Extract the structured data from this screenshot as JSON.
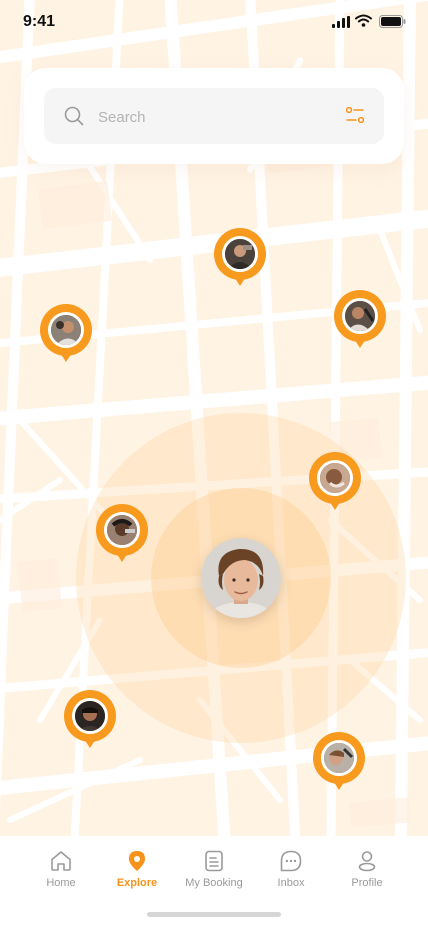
{
  "status_bar": {
    "time": "9:41"
  },
  "search": {
    "placeholder": "Search"
  },
  "colors": {
    "accent": "#f79a1e",
    "map_background": "#fff3e4",
    "streets": "#ffffff",
    "inactive": "#9a9a9a"
  },
  "map": {
    "user_marker": {
      "icon": "user-avatar"
    },
    "barber_pins": [
      {
        "icon": "barber-photo"
      },
      {
        "icon": "barber-photo"
      },
      {
        "icon": "barber-photo"
      },
      {
        "icon": "barber-photo"
      },
      {
        "icon": "barber-photo"
      },
      {
        "icon": "barber-photo"
      },
      {
        "icon": "barber-photo"
      }
    ]
  },
  "nav": {
    "items": [
      {
        "label": "Home",
        "icon": "home-icon",
        "active": false
      },
      {
        "label": "Explore",
        "icon": "location-pin-icon",
        "active": true
      },
      {
        "label": "My Booking",
        "icon": "document-icon",
        "active": false
      },
      {
        "label": "Inbox",
        "icon": "chat-icon",
        "active": false
      },
      {
        "label": "Profile",
        "icon": "profile-icon",
        "active": false
      }
    ]
  }
}
